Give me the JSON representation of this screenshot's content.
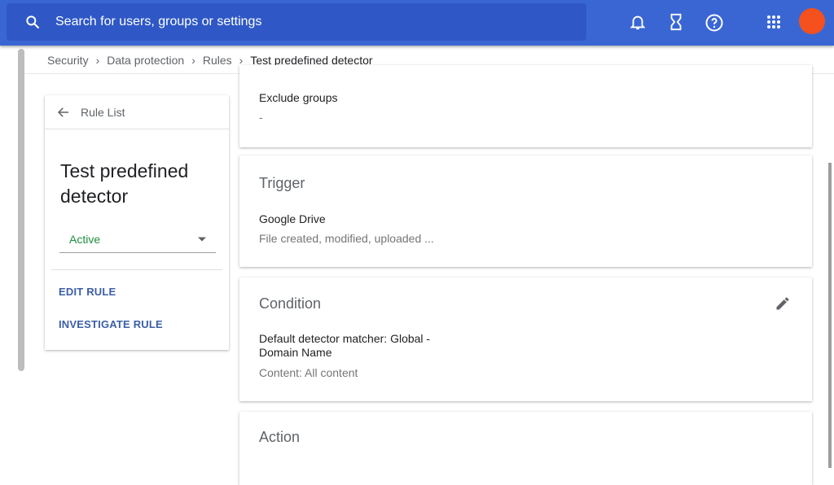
{
  "header": {
    "search_placeholder": "Search for users, groups or settings",
    "avatar_color": "#f4511e",
    "icons": [
      "search-icon",
      "bell-icon",
      "hourglass-icon",
      "help-icon",
      "apps-grid-icon"
    ]
  },
  "breadcrumb": [
    "Security",
    "Data protection",
    "Rules",
    "Test predefined detector"
  ],
  "sidebar": {
    "back_label": "Rule List",
    "title": "Test predefined detector",
    "status": "Active",
    "edit": "EDIT RULE",
    "investigate": "INVESTIGATE RULE"
  },
  "cards": {
    "exclude": {
      "label": "Exclude groups",
      "value": "-"
    },
    "trigger": {
      "title": "Trigger",
      "label": "Google Drive",
      "value": "File created, modified, uploaded ..."
    },
    "condition": {
      "title": "Condition",
      "label": "Default detector matcher: Global - Domain Name",
      "value": "Content: All content"
    },
    "action": {
      "title": "Action"
    }
  }
}
